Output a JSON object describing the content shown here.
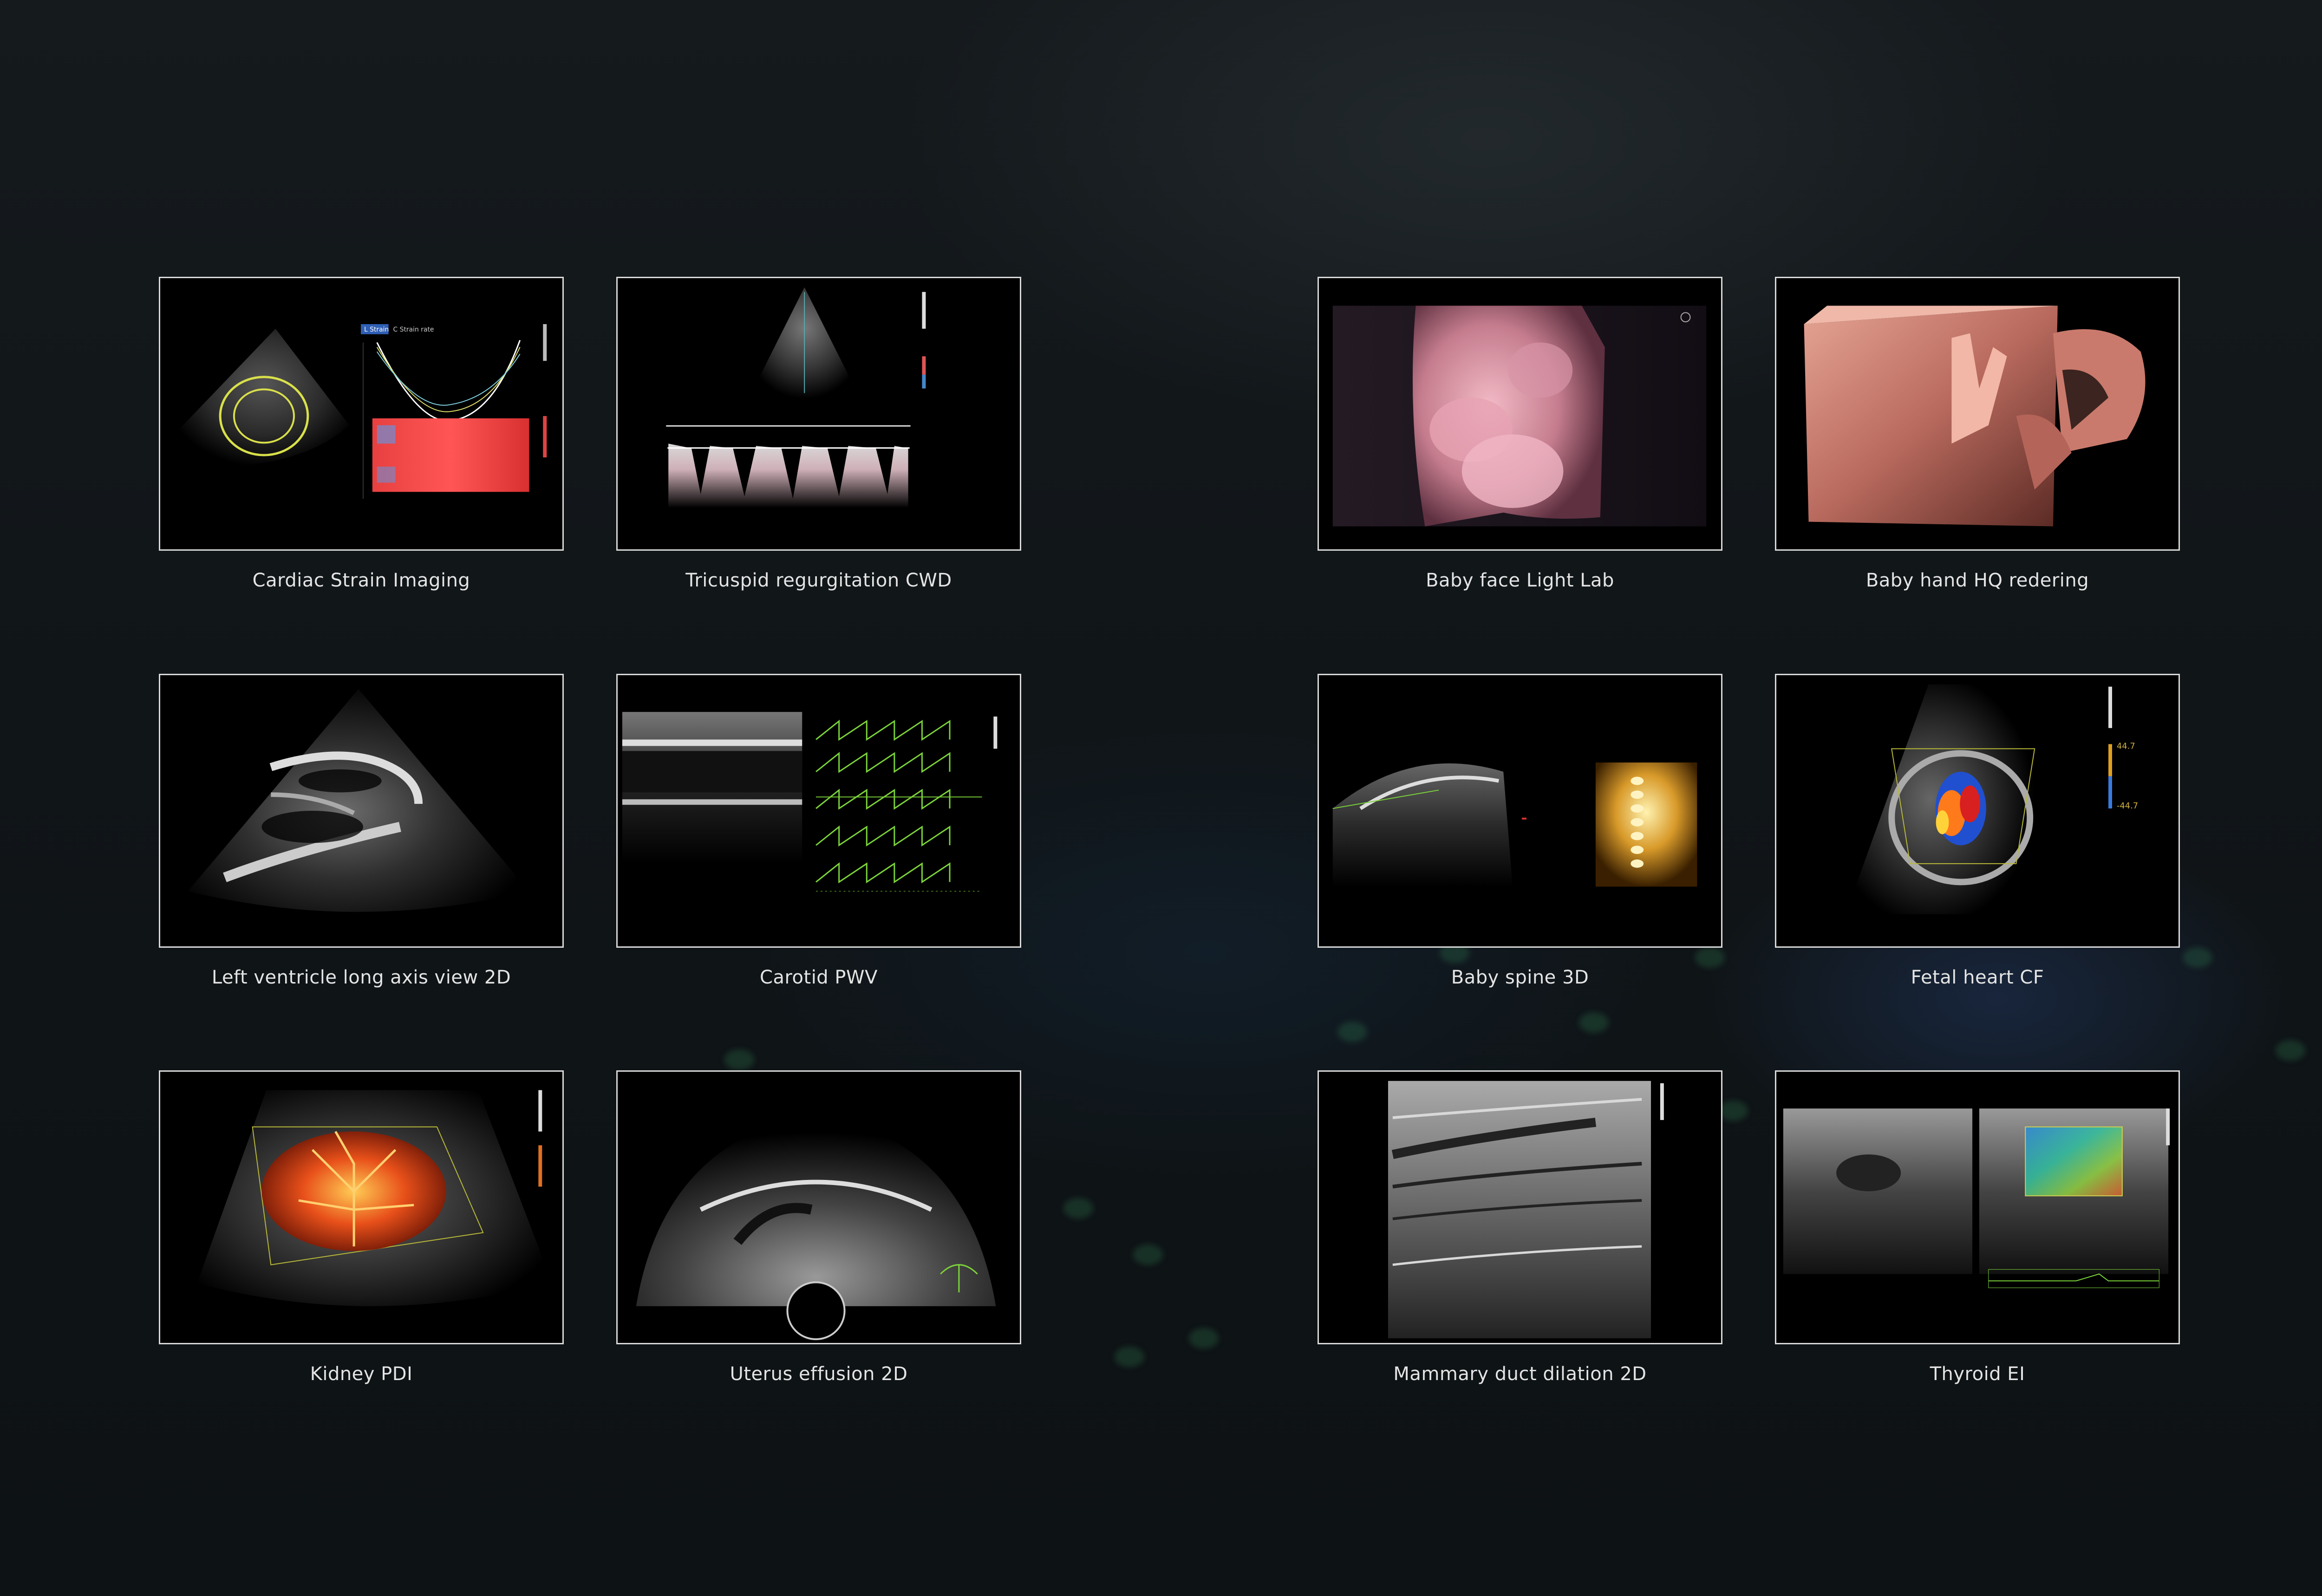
{
  "panels": [
    {
      "id": "cardiac-strain",
      "caption": "Cardiac Strain Imaging",
      "tab_labels": [
        "L Strain",
        "C Strain rate"
      ]
    },
    {
      "id": "tricuspid-cwd",
      "caption": "Tricuspid regurgitation CWD"
    },
    {
      "id": "baby-face",
      "caption": "Baby face Light Lab"
    },
    {
      "id": "baby-hand",
      "caption": "Baby hand HQ redering"
    },
    {
      "id": "lv-long-axis",
      "caption": "Left ventricle long axis view 2D"
    },
    {
      "id": "carotid-pwv",
      "caption": "Carotid PWV"
    },
    {
      "id": "baby-spine",
      "caption": "Baby spine 3D"
    },
    {
      "id": "fetal-heart",
      "caption": "Fetal heart CF",
      "scale_labels": [
        "44.7",
        "-44.7"
      ]
    },
    {
      "id": "kidney-pdi",
      "caption": "Kidney PDI"
    },
    {
      "id": "uterus-effusion",
      "caption": "Uterus effusion 2D"
    },
    {
      "id": "mammary-duct",
      "caption": "Mammary duct dilation 2D"
    },
    {
      "id": "thyroid-ei",
      "caption": "Thyroid EI"
    }
  ],
  "colors": {
    "background": "#101417",
    "panel_border": "#d8d8d8",
    "caption_text": "#e4e4e4",
    "ultrasound_green": "#7bd33a"
  }
}
